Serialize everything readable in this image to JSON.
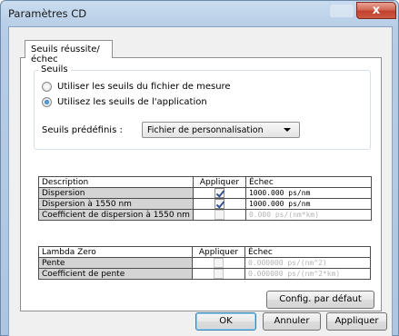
{
  "window": {
    "title": "Paramètres CD",
    "close_glyph": "x"
  },
  "tabs": [
    {
      "label": "Seuils réussite/échec"
    }
  ],
  "seuils_group": {
    "legend": "Seuils",
    "radio_options": [
      {
        "label": "Utiliser les seuils du fichier de mesure",
        "selected": false
      },
      {
        "label": "Utilisez les seuils de l'application",
        "selected": true
      }
    ],
    "preset_label": "Seuils prédéfinis :",
    "preset_value": "Fichier de personnalisation"
  },
  "dispersion_table": {
    "headers": [
      "Description",
      "Appliquer",
      "Échec"
    ],
    "rows": [
      {
        "description": "Dispersion",
        "apply": true,
        "enabled": true,
        "value": "1000.000 ps/nm"
      },
      {
        "description": "Dispersion à 1550 nm",
        "apply": true,
        "enabled": true,
        "value": "1000.000 ps/nm"
      },
      {
        "description": "Coefficient de dispersion à 1550 nm",
        "apply": false,
        "enabled": false,
        "value": "0.000 ps/(nm*km)"
      }
    ]
  },
  "lambda_table": {
    "headers": [
      "Lambda Zero",
      "Appliquer",
      "Échec"
    ],
    "rows": [
      {
        "description": "Pente",
        "apply": false,
        "enabled": false,
        "value": "0.000000 ps/(nm^2)"
      },
      {
        "description": "Coefficient de pente",
        "apply": false,
        "enabled": false,
        "value": "0.000000 ps/(nm^2*km)"
      }
    ]
  },
  "buttons": {
    "defaults": "Config. par défaut",
    "ok": "OK",
    "cancel": "Annuler",
    "apply": "Appliquer"
  }
}
